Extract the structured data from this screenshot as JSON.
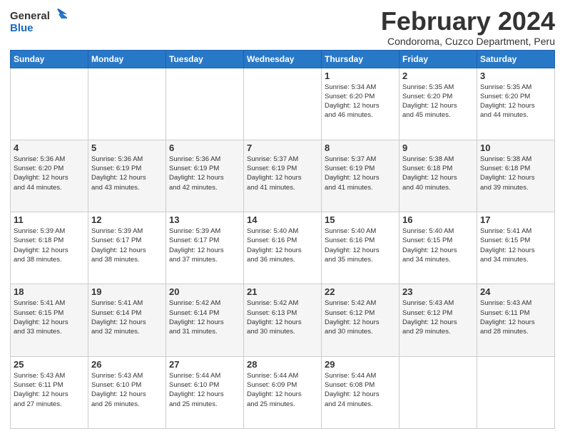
{
  "logo": {
    "line1": "General",
    "line2": "Blue"
  },
  "title": "February 2024",
  "subtitle": "Condoroma, Cuzco Department, Peru",
  "days_header": [
    "Sunday",
    "Monday",
    "Tuesday",
    "Wednesday",
    "Thursday",
    "Friday",
    "Saturday"
  ],
  "weeks": [
    [
      {
        "day": "",
        "info": ""
      },
      {
        "day": "",
        "info": ""
      },
      {
        "day": "",
        "info": ""
      },
      {
        "day": "",
        "info": ""
      },
      {
        "day": "1",
        "info": "Sunrise: 5:34 AM\nSunset: 6:20 PM\nDaylight: 12 hours\nand 46 minutes."
      },
      {
        "day": "2",
        "info": "Sunrise: 5:35 AM\nSunset: 6:20 PM\nDaylight: 12 hours\nand 45 minutes."
      },
      {
        "day": "3",
        "info": "Sunrise: 5:35 AM\nSunset: 6:20 PM\nDaylight: 12 hours\nand 44 minutes."
      }
    ],
    [
      {
        "day": "4",
        "info": "Sunrise: 5:36 AM\nSunset: 6:20 PM\nDaylight: 12 hours\nand 44 minutes."
      },
      {
        "day": "5",
        "info": "Sunrise: 5:36 AM\nSunset: 6:19 PM\nDaylight: 12 hours\nand 43 minutes."
      },
      {
        "day": "6",
        "info": "Sunrise: 5:36 AM\nSunset: 6:19 PM\nDaylight: 12 hours\nand 42 minutes."
      },
      {
        "day": "7",
        "info": "Sunrise: 5:37 AM\nSunset: 6:19 PM\nDaylight: 12 hours\nand 41 minutes."
      },
      {
        "day": "8",
        "info": "Sunrise: 5:37 AM\nSunset: 6:19 PM\nDaylight: 12 hours\nand 41 minutes."
      },
      {
        "day": "9",
        "info": "Sunrise: 5:38 AM\nSunset: 6:18 PM\nDaylight: 12 hours\nand 40 minutes."
      },
      {
        "day": "10",
        "info": "Sunrise: 5:38 AM\nSunset: 6:18 PM\nDaylight: 12 hours\nand 39 minutes."
      }
    ],
    [
      {
        "day": "11",
        "info": "Sunrise: 5:39 AM\nSunset: 6:18 PM\nDaylight: 12 hours\nand 38 minutes."
      },
      {
        "day": "12",
        "info": "Sunrise: 5:39 AM\nSunset: 6:17 PM\nDaylight: 12 hours\nand 38 minutes."
      },
      {
        "day": "13",
        "info": "Sunrise: 5:39 AM\nSunset: 6:17 PM\nDaylight: 12 hours\nand 37 minutes."
      },
      {
        "day": "14",
        "info": "Sunrise: 5:40 AM\nSunset: 6:16 PM\nDaylight: 12 hours\nand 36 minutes."
      },
      {
        "day": "15",
        "info": "Sunrise: 5:40 AM\nSunset: 6:16 PM\nDaylight: 12 hours\nand 35 minutes."
      },
      {
        "day": "16",
        "info": "Sunrise: 5:40 AM\nSunset: 6:15 PM\nDaylight: 12 hours\nand 34 minutes."
      },
      {
        "day": "17",
        "info": "Sunrise: 5:41 AM\nSunset: 6:15 PM\nDaylight: 12 hours\nand 34 minutes."
      }
    ],
    [
      {
        "day": "18",
        "info": "Sunrise: 5:41 AM\nSunset: 6:15 PM\nDaylight: 12 hours\nand 33 minutes."
      },
      {
        "day": "19",
        "info": "Sunrise: 5:41 AM\nSunset: 6:14 PM\nDaylight: 12 hours\nand 32 minutes."
      },
      {
        "day": "20",
        "info": "Sunrise: 5:42 AM\nSunset: 6:14 PM\nDaylight: 12 hours\nand 31 minutes."
      },
      {
        "day": "21",
        "info": "Sunrise: 5:42 AM\nSunset: 6:13 PM\nDaylight: 12 hours\nand 30 minutes."
      },
      {
        "day": "22",
        "info": "Sunrise: 5:42 AM\nSunset: 6:12 PM\nDaylight: 12 hours\nand 30 minutes."
      },
      {
        "day": "23",
        "info": "Sunrise: 5:43 AM\nSunset: 6:12 PM\nDaylight: 12 hours\nand 29 minutes."
      },
      {
        "day": "24",
        "info": "Sunrise: 5:43 AM\nSunset: 6:11 PM\nDaylight: 12 hours\nand 28 minutes."
      }
    ],
    [
      {
        "day": "25",
        "info": "Sunrise: 5:43 AM\nSunset: 6:11 PM\nDaylight: 12 hours\nand 27 minutes."
      },
      {
        "day": "26",
        "info": "Sunrise: 5:43 AM\nSunset: 6:10 PM\nDaylight: 12 hours\nand 26 minutes."
      },
      {
        "day": "27",
        "info": "Sunrise: 5:44 AM\nSunset: 6:10 PM\nDaylight: 12 hours\nand 25 minutes."
      },
      {
        "day": "28",
        "info": "Sunrise: 5:44 AM\nSunset: 6:09 PM\nDaylight: 12 hours\nand 25 minutes."
      },
      {
        "day": "29",
        "info": "Sunrise: 5:44 AM\nSunset: 6:08 PM\nDaylight: 12 hours\nand 24 minutes."
      },
      {
        "day": "",
        "info": ""
      },
      {
        "day": "",
        "info": ""
      }
    ]
  ]
}
